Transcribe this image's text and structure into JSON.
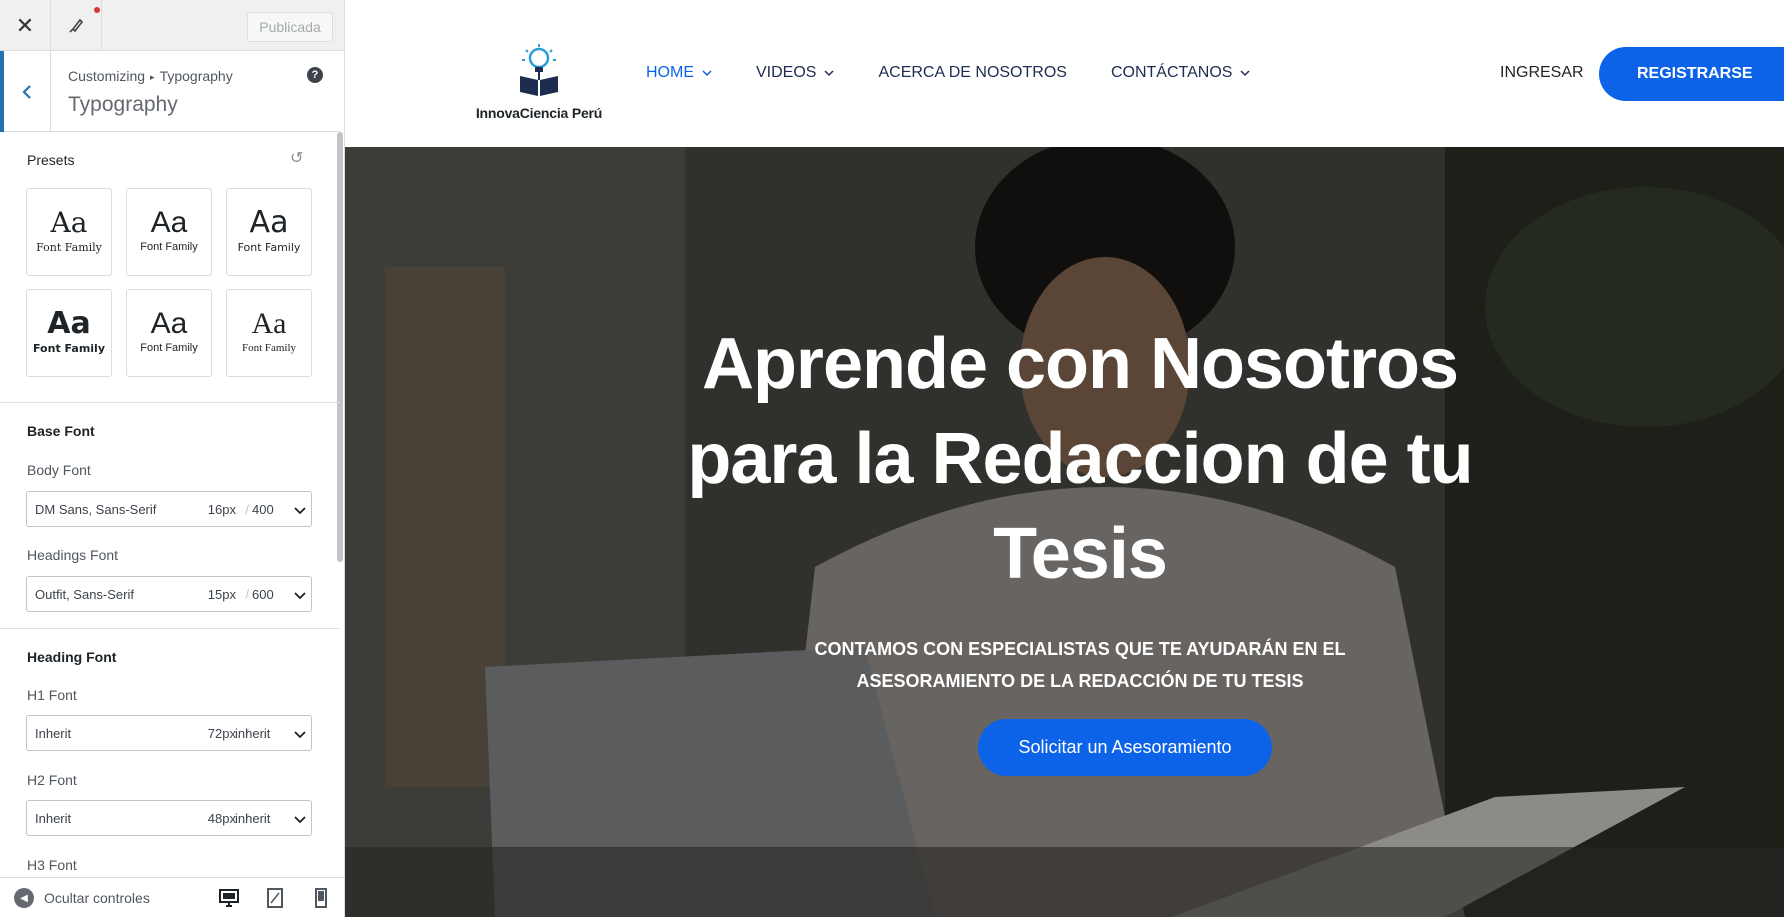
{
  "topbar": {
    "close_icon": "close-icon",
    "style_icon": "paintbrush-icon",
    "publish_label": "Publicada",
    "notification_color": "#d63638"
  },
  "panel": {
    "breadcrumb_root": "Customizing",
    "breadcrumb_current": "Typography",
    "title": "Typography",
    "help_symbol": "?"
  },
  "presets": {
    "label": "Presets",
    "reset_icon": "reset-icon",
    "items": [
      {
        "aa": "Aa",
        "label": "Font Family"
      },
      {
        "aa": "Aa",
        "label": "Font Family"
      },
      {
        "aa": "Aa",
        "label": "Font Family"
      },
      {
        "aa": "Aa",
        "label": "Font Family"
      },
      {
        "aa": "Aa",
        "label": "Font Family"
      },
      {
        "aa": "Aa",
        "label": "Font Family"
      }
    ]
  },
  "base_font": {
    "heading": "Base Font",
    "body": {
      "label": "Body Font",
      "family": "DM Sans, Sans-Serif",
      "size": "16px",
      "weight": "400"
    },
    "headings": {
      "label": "Headings Font",
      "family": "Outfit, Sans-Serif",
      "size": "15px",
      "weight": "600"
    }
  },
  "heading_font": {
    "heading": "Heading Font",
    "h1": {
      "label": "H1 Font",
      "family": "Inherit",
      "size": "72px",
      "weight": "inherit"
    },
    "h2": {
      "label": "H2 Font",
      "family": "Inherit",
      "size": "48px",
      "weight": "inherit"
    },
    "h3": {
      "label": "H3 Font"
    }
  },
  "footer": {
    "hide_controls": "Ocultar controles",
    "devices": [
      "desktop-icon",
      "tablet-icon",
      "mobile-icon"
    ]
  },
  "site": {
    "logo_text": "InnovaCiencia Perú",
    "nav": [
      {
        "label": "HOME",
        "active": true,
        "dropdown": true
      },
      {
        "label": "VIDEOS",
        "active": false,
        "dropdown": true
      },
      {
        "label": "ACERCA DE NOSOTROS",
        "active": false,
        "dropdown": false
      },
      {
        "label": "CONTÁCTANOS",
        "active": false,
        "dropdown": true
      }
    ],
    "login": "INGRESAR",
    "register": "REGISTRARSE",
    "accent": "#0d63e8"
  },
  "hero": {
    "title_line1": "Aprende con Nosotros",
    "title_line2": "para la Redaccion de tu",
    "title_line3": "Tesis",
    "subtitle_line1": "CONTAMOS CON ESPECIALISTAS QUE TE AYUDARÁN EN EL",
    "subtitle_line2": "ASESORAMIENTO DE LA REDACCIÓN DE TU TESIS",
    "cta": "Solicitar un Asesoramiento"
  }
}
